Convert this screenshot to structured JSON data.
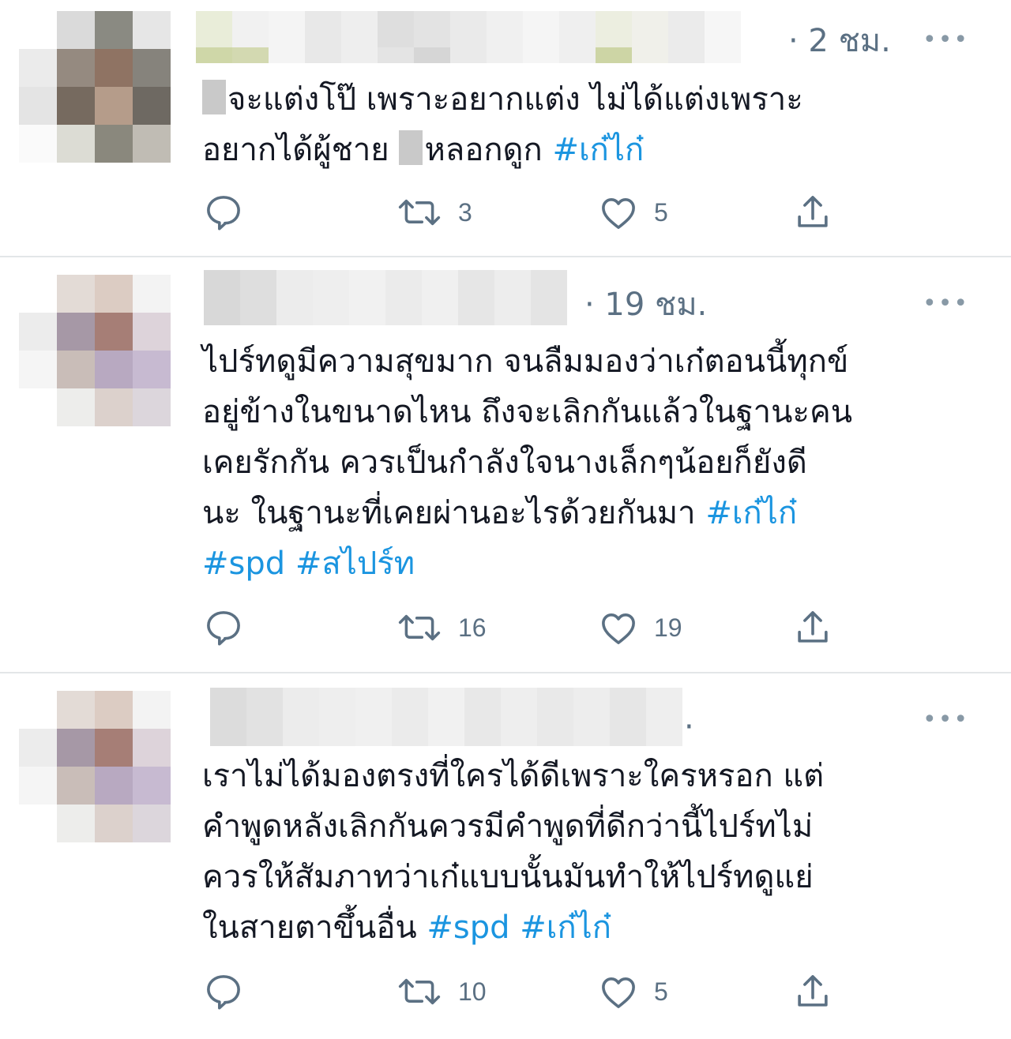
{
  "tweets": [
    {
      "time": "· 2 ชม.",
      "more": "•••",
      "text_parts": [
        "จะแต่งโป๊ เพราะอยากแต่ง ไม่ได้แต่งเพราะ",
        "อยากได้ผู้ชาย",
        "หลอกดูก"
      ],
      "hashtags": [
        "#เก๋ไก๋"
      ],
      "counts": {
        "reply": "",
        "retweet": "3",
        "like": "5"
      }
    },
    {
      "time": "· 19 ชม.",
      "more": "•••",
      "lines": [
        "ไปร์ทดูมีความสุขมาก จนลืมมองว่าเก๋ตอนนี้ทุกข์",
        "อยู่ข้างในขนาดไหน ถึงจะเลิกกันแล้วในฐานะคน",
        "เคยรักกัน ควรเป็นกำลังใจนางเล็กๆน้อยก็ยังดี",
        "นะ ในฐานะที่เคยผ่านอะไรด้วยกันมา"
      ],
      "hashtags": [
        "#เก๋ไก๋",
        "#spd",
        "#สไปร์ท"
      ],
      "counts": {
        "reply": "",
        "retweet": "16",
        "like": "19"
      }
    },
    {
      "time": "·",
      "more": "•••",
      "lines": [
        "เราไม่ได้มองตรงที่ใครได้ดีเพราะใครหรอก แต่",
        "คำพูดหลังเลิกกันควรมีคำพูดที่ดีกว่านี้ไปร์ทไม่",
        "ควรให้สัมภาทว่าเก๋แบบนั้นมันทำให้ไปร์ทดูแย่",
        "ในสายตาขึ้นอื่น"
      ],
      "hashtags": [
        "#spd",
        "#เก๋ไก๋"
      ],
      "counts": {
        "reply": "",
        "retweet": "10",
        "like": "5"
      }
    }
  ],
  "colors": {
    "text": "#141823",
    "meta": "#5b7083",
    "hashtag": "#1b95e0",
    "divider": "#e3e6e8"
  },
  "icons": [
    "reply-icon",
    "retweet-icon",
    "like-icon",
    "share-icon",
    "more-icon"
  ]
}
